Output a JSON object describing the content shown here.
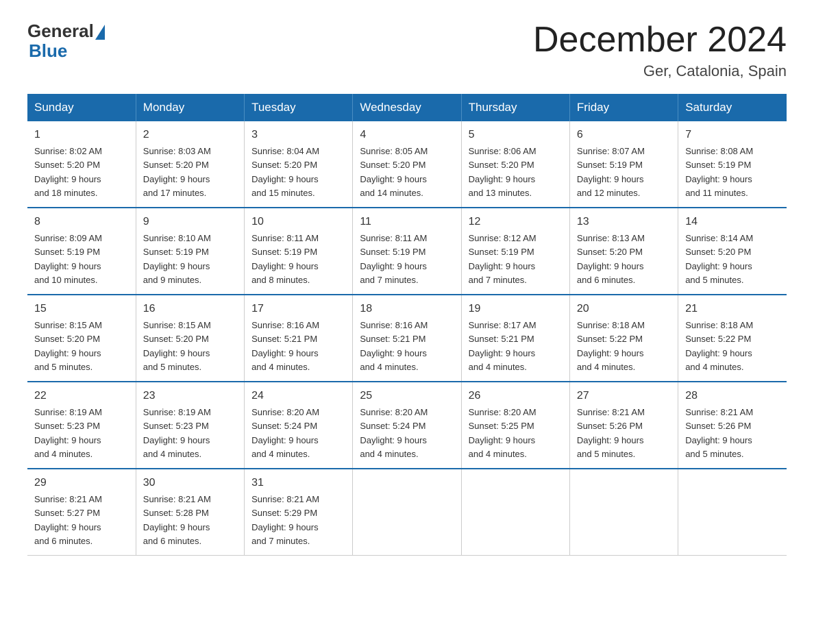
{
  "logo": {
    "general": "General",
    "blue": "Blue"
  },
  "title": "December 2024",
  "subtitle": "Ger, Catalonia, Spain",
  "headers": [
    "Sunday",
    "Monday",
    "Tuesday",
    "Wednesday",
    "Thursday",
    "Friday",
    "Saturday"
  ],
  "weeks": [
    [
      {
        "day": "1",
        "info": "Sunrise: 8:02 AM\nSunset: 5:20 PM\nDaylight: 9 hours\nand 18 minutes."
      },
      {
        "day": "2",
        "info": "Sunrise: 8:03 AM\nSunset: 5:20 PM\nDaylight: 9 hours\nand 17 minutes."
      },
      {
        "day": "3",
        "info": "Sunrise: 8:04 AM\nSunset: 5:20 PM\nDaylight: 9 hours\nand 15 minutes."
      },
      {
        "day": "4",
        "info": "Sunrise: 8:05 AM\nSunset: 5:20 PM\nDaylight: 9 hours\nand 14 minutes."
      },
      {
        "day": "5",
        "info": "Sunrise: 8:06 AM\nSunset: 5:20 PM\nDaylight: 9 hours\nand 13 minutes."
      },
      {
        "day": "6",
        "info": "Sunrise: 8:07 AM\nSunset: 5:19 PM\nDaylight: 9 hours\nand 12 minutes."
      },
      {
        "day": "7",
        "info": "Sunrise: 8:08 AM\nSunset: 5:19 PM\nDaylight: 9 hours\nand 11 minutes."
      }
    ],
    [
      {
        "day": "8",
        "info": "Sunrise: 8:09 AM\nSunset: 5:19 PM\nDaylight: 9 hours\nand 10 minutes."
      },
      {
        "day": "9",
        "info": "Sunrise: 8:10 AM\nSunset: 5:19 PM\nDaylight: 9 hours\nand 9 minutes."
      },
      {
        "day": "10",
        "info": "Sunrise: 8:11 AM\nSunset: 5:19 PM\nDaylight: 9 hours\nand 8 minutes."
      },
      {
        "day": "11",
        "info": "Sunrise: 8:11 AM\nSunset: 5:19 PM\nDaylight: 9 hours\nand 7 minutes."
      },
      {
        "day": "12",
        "info": "Sunrise: 8:12 AM\nSunset: 5:19 PM\nDaylight: 9 hours\nand 7 minutes."
      },
      {
        "day": "13",
        "info": "Sunrise: 8:13 AM\nSunset: 5:20 PM\nDaylight: 9 hours\nand 6 minutes."
      },
      {
        "day": "14",
        "info": "Sunrise: 8:14 AM\nSunset: 5:20 PM\nDaylight: 9 hours\nand 5 minutes."
      }
    ],
    [
      {
        "day": "15",
        "info": "Sunrise: 8:15 AM\nSunset: 5:20 PM\nDaylight: 9 hours\nand 5 minutes."
      },
      {
        "day": "16",
        "info": "Sunrise: 8:15 AM\nSunset: 5:20 PM\nDaylight: 9 hours\nand 5 minutes."
      },
      {
        "day": "17",
        "info": "Sunrise: 8:16 AM\nSunset: 5:21 PM\nDaylight: 9 hours\nand 4 minutes."
      },
      {
        "day": "18",
        "info": "Sunrise: 8:16 AM\nSunset: 5:21 PM\nDaylight: 9 hours\nand 4 minutes."
      },
      {
        "day": "19",
        "info": "Sunrise: 8:17 AM\nSunset: 5:21 PM\nDaylight: 9 hours\nand 4 minutes."
      },
      {
        "day": "20",
        "info": "Sunrise: 8:18 AM\nSunset: 5:22 PM\nDaylight: 9 hours\nand 4 minutes."
      },
      {
        "day": "21",
        "info": "Sunrise: 8:18 AM\nSunset: 5:22 PM\nDaylight: 9 hours\nand 4 minutes."
      }
    ],
    [
      {
        "day": "22",
        "info": "Sunrise: 8:19 AM\nSunset: 5:23 PM\nDaylight: 9 hours\nand 4 minutes."
      },
      {
        "day": "23",
        "info": "Sunrise: 8:19 AM\nSunset: 5:23 PM\nDaylight: 9 hours\nand 4 minutes."
      },
      {
        "day": "24",
        "info": "Sunrise: 8:20 AM\nSunset: 5:24 PM\nDaylight: 9 hours\nand 4 minutes."
      },
      {
        "day": "25",
        "info": "Sunrise: 8:20 AM\nSunset: 5:24 PM\nDaylight: 9 hours\nand 4 minutes."
      },
      {
        "day": "26",
        "info": "Sunrise: 8:20 AM\nSunset: 5:25 PM\nDaylight: 9 hours\nand 4 minutes."
      },
      {
        "day": "27",
        "info": "Sunrise: 8:21 AM\nSunset: 5:26 PM\nDaylight: 9 hours\nand 5 minutes."
      },
      {
        "day": "28",
        "info": "Sunrise: 8:21 AM\nSunset: 5:26 PM\nDaylight: 9 hours\nand 5 minutes."
      }
    ],
    [
      {
        "day": "29",
        "info": "Sunrise: 8:21 AM\nSunset: 5:27 PM\nDaylight: 9 hours\nand 6 minutes."
      },
      {
        "day": "30",
        "info": "Sunrise: 8:21 AM\nSunset: 5:28 PM\nDaylight: 9 hours\nand 6 minutes."
      },
      {
        "day": "31",
        "info": "Sunrise: 8:21 AM\nSunset: 5:29 PM\nDaylight: 9 hours\nand 7 minutes."
      },
      null,
      null,
      null,
      null
    ]
  ]
}
